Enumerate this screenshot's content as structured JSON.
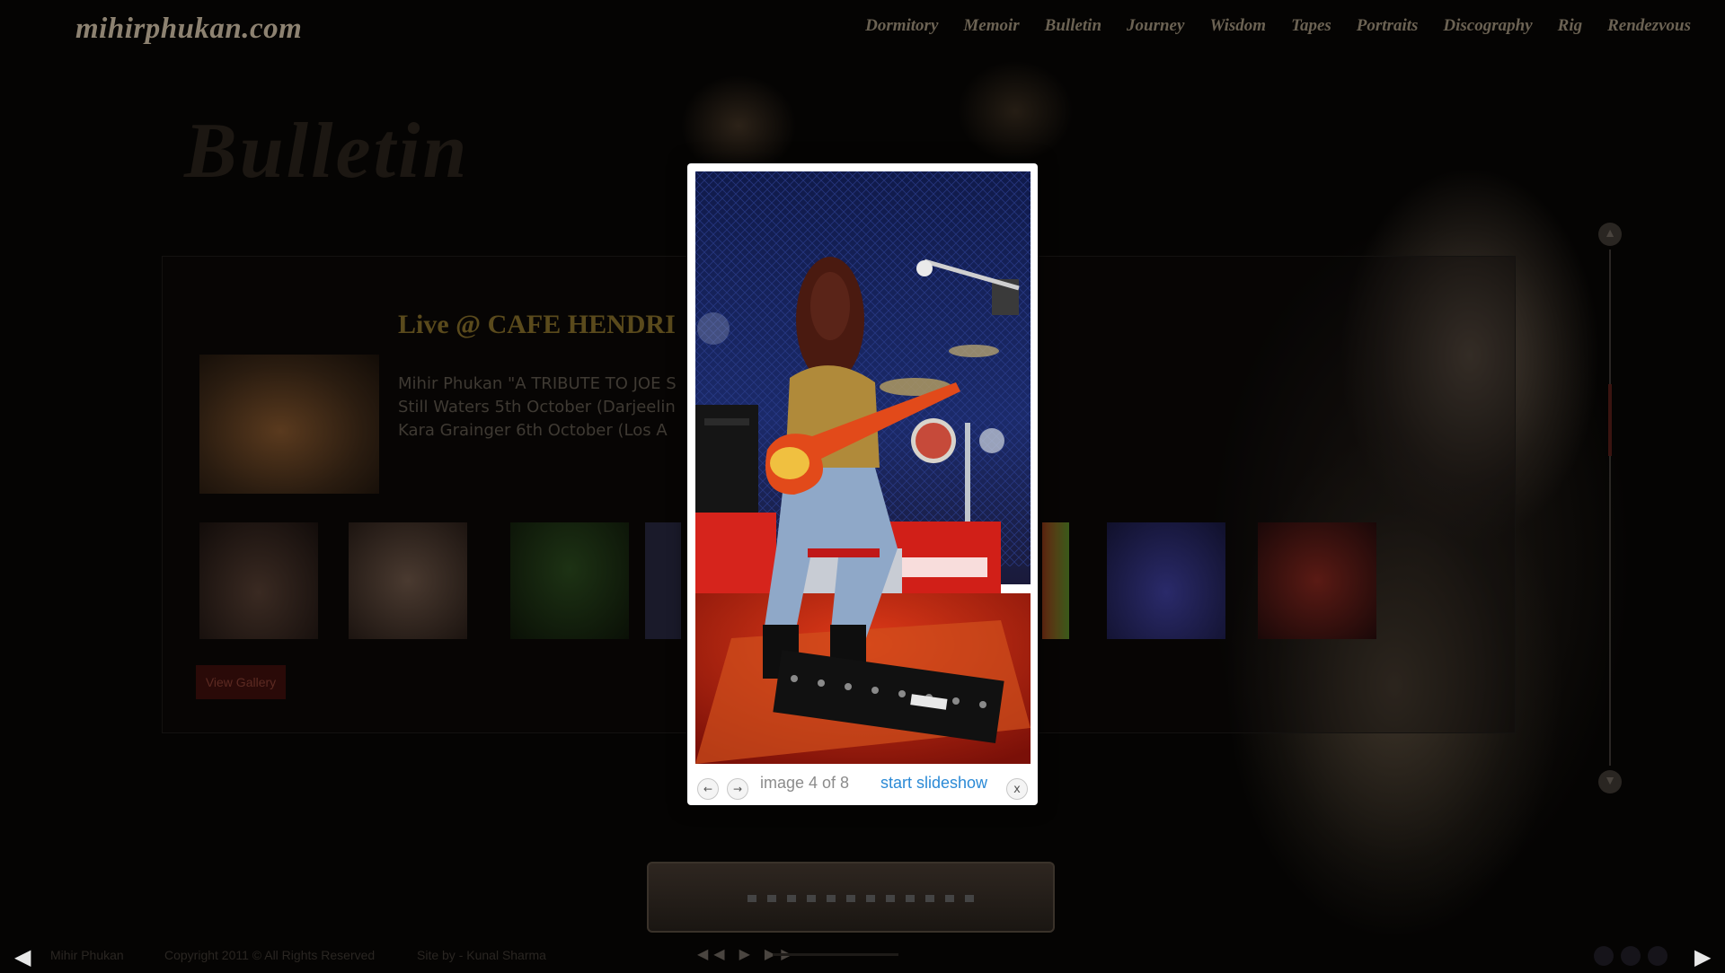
{
  "header": {
    "logo": "mihirphukan.com",
    "nav": [
      "Dormitory",
      "Memoir",
      "Bulletin",
      "Journey",
      "Wisdom",
      "Tapes",
      "Portraits",
      "Discography",
      "Rig",
      "Rendezvous"
    ]
  },
  "page": {
    "banner": "Bulletin",
    "post": {
      "title": "Live @ CAFE HENDRI",
      "lines": [
        "Mihir Phukan \"A TRIBUTE TO JOE S",
        "Still Waters 5th October (Darjeelin",
        "Kara Grainger 6th October (Los A"
      ]
    },
    "view_gallery_label": "View Gallery",
    "scroll_up_icon": "▲",
    "scroll_down_icon": "▼"
  },
  "footer": {
    "left_arrow": "◀",
    "right_arrow": "▶",
    "name": "Mihir Phukan",
    "copyright": "Copyright 2011 © All Rights Reserved",
    "site_by": "Site by - Kunal Sharma",
    "player_controls": "◀◀ ▶ ▶▶"
  },
  "lightbox": {
    "counter": "image 4 of 8",
    "slideshow_label": "start slideshow",
    "prev_icon": "←",
    "next_icon": "→",
    "close_icon": "x"
  },
  "colors": {
    "accent_link": "#2b8ad6",
    "background": "#050403",
    "lightbox_frame": "#ffffff"
  }
}
